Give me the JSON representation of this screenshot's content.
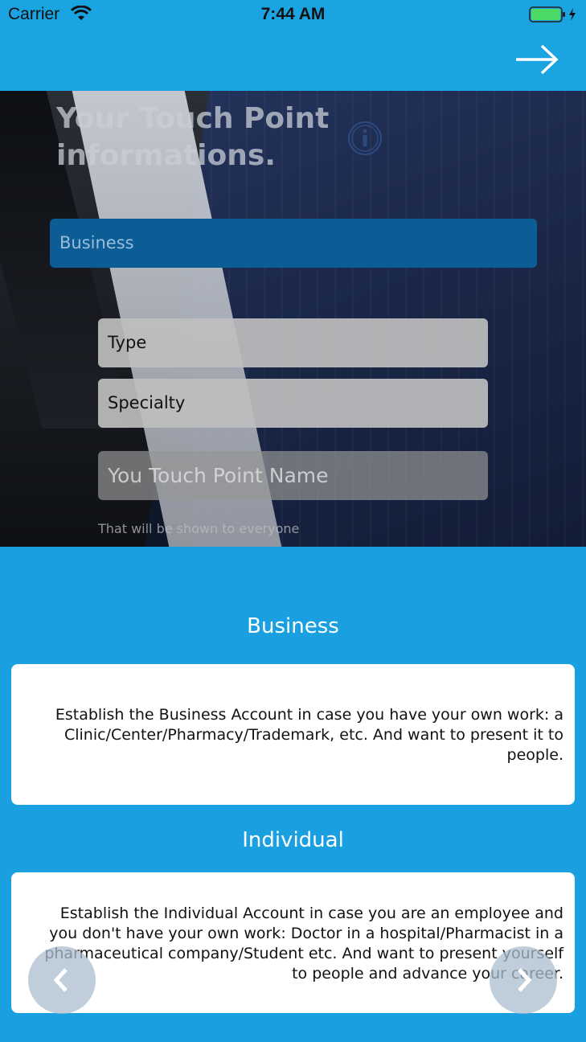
{
  "status_bar": {
    "carrier": "Carrier",
    "time": "7:44 AM"
  },
  "header": {
    "next_icon": "arrow-right-icon"
  },
  "hero": {
    "title": "Your Touch Point informations.",
    "info_icon": "info-icon",
    "account_type_value": "Business",
    "type_label": "Type",
    "specialty_label": "Specialty",
    "name_placeholder": "You Touch Point Name",
    "name_hint": "That will be shown to everyone"
  },
  "info": {
    "business_heading": "Business",
    "business_text": "Establish the Business Account in case you have your own work: a Clinic/Center/Pharmacy/Trademark, etc. And want to present it to people.",
    "individual_heading": "Individual",
    "individual_text": "Establish the Individual Account in case you are an employee and you don't have your own work: Doctor in a hospital/Pharmacist in a pharmaceutical company/Student etc. And want to present yourself to people and advance your career."
  },
  "pager": {
    "prev_icon": "chevron-left-icon",
    "next_icon": "chevron-right-icon"
  },
  "colors": {
    "primary": "#1aa4e2",
    "selected_bar": "#0c5d95",
    "card": "#ffffff"
  }
}
